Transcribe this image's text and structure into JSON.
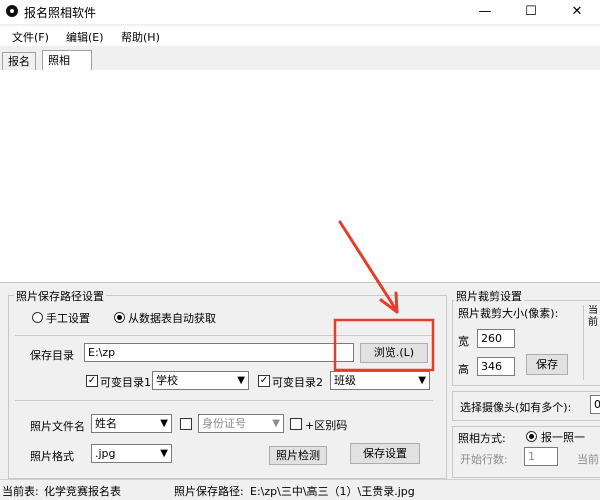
{
  "window": {
    "title": "报名照相软件",
    "minimize": "—",
    "maximize": "☐",
    "close": "✕"
  },
  "menu": [
    "文件(F)",
    "编辑(E)",
    "帮助(H)"
  ],
  "tabs": [
    {
      "label": "报名",
      "active": false
    },
    {
      "label": "照相",
      "active": true
    }
  ],
  "save_path": {
    "group_title": "照片保存路径设置",
    "manual_label": "手工设置",
    "auto_label": "从数据表自动获取",
    "selected": "auto",
    "dir_label": "保存目录",
    "dir_value": "E:\\zp",
    "browse_label": "浏览.(L)",
    "var_dir1_label": "可变目录1",
    "var_dir1_value": "学校",
    "var_dir1_checked": true,
    "var_dir2_label": "可变目录2",
    "var_dir2_value": "班级",
    "var_dir2_checked": true,
    "prefix_label": "照片文件名",
    "prefix_value": "姓名",
    "idcard_value": "身份证号",
    "idcard_checked": false,
    "extra_label": "+区别码",
    "extra_checked": false,
    "format_label": "照片格式",
    "format_value": ".jpg",
    "check_button": "照片检测",
    "save_button": "保存设置"
  },
  "crop": {
    "group_title": "照片裁剪设置",
    "size_label": "照片裁剪大小(像素):",
    "width_label": "宽",
    "width_value": "260",
    "height_label": "高",
    "height_value": "346",
    "save_button": "保存",
    "side_text": "当前…",
    "camera_label": "选择摄像头(如有多个):",
    "camera_value": "0",
    "mode_label": "照相方式:",
    "mode_option": "报一照一",
    "start_row_label": "开始行数:",
    "start_row_value": "1",
    "current_label": "当前"
  },
  "status": {
    "current_table_label": "当前表:",
    "current_table": "化学竞赛报名表",
    "photo_path_label": "照片保存路径:",
    "photo_path": "E:\\zp\\三中\\高三（1）\\王贵录.jpg"
  },
  "colors": {
    "annotation": "#e53d2a",
    "window_bg": "#f0f0f0"
  }
}
